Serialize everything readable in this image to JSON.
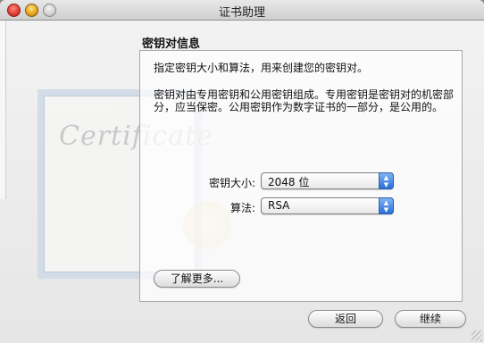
{
  "window": {
    "title": "证书助理"
  },
  "section": {
    "title": "密钥对信息"
  },
  "panel": {
    "line1": "指定密钥大小和算法，用来创建您的密钥对。",
    "line2": "密钥对由专用密钥和公用密钥组成。专用密钥是密钥对的机密部",
    "line3": "分，应当保密。公用密钥作为数字证书的一部分，是公用的。"
  },
  "background": {
    "watermark": "Certificate"
  },
  "fields": {
    "key_size": {
      "label": "密钥大小:",
      "value": "2048 位"
    },
    "algorithm": {
      "label": "算法:",
      "value": "RSA"
    }
  },
  "buttons": {
    "learn_more": "了解更多...",
    "back": "返回",
    "continue": "继续"
  },
  "icons": {
    "close": "close-traffic-light",
    "minimize": "minimize-traffic-light",
    "zoom": "zoom-traffic-light",
    "popup_arrows": "up-down-arrows-icon"
  },
  "colors": {
    "accent": "#2a6ed8",
    "close": "#e0443b",
    "minimize": "#e6a51c"
  }
}
